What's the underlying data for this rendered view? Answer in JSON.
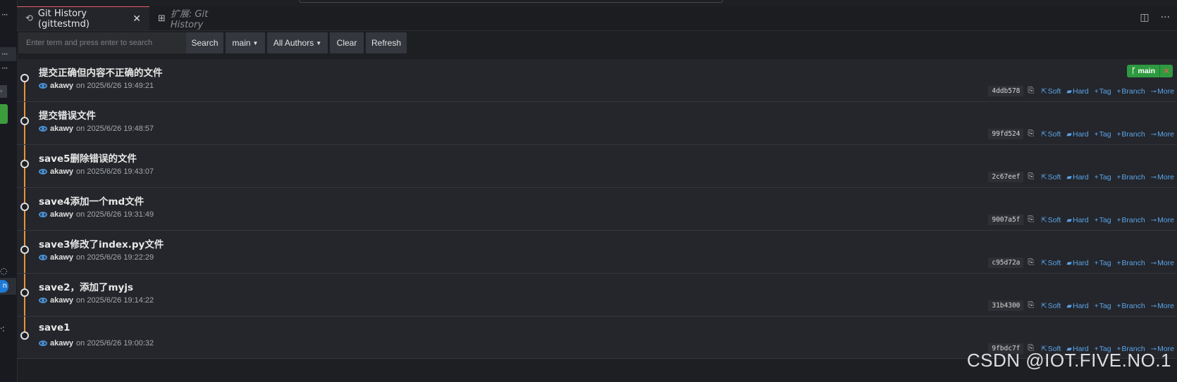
{
  "tabs": [
    {
      "label": "Git History (gittestmd)",
      "icon": "history-icon",
      "active": true
    },
    {
      "label": "扩展: Git History",
      "icon": "extensions-icon",
      "active": false
    }
  ],
  "toolbar": {
    "search_placeholder": "Enter term and press enter to search",
    "search_label": "Search",
    "branch_label": "main",
    "authors_label": "All Authors",
    "clear_label": "Clear",
    "refresh_label": "Refresh"
  },
  "branch_badge": {
    "label": "main",
    "color": "#2e9a40"
  },
  "action_labels": {
    "soft": "Soft",
    "hard": "Hard",
    "tag": "Tag",
    "branch": "Branch",
    "more": "More"
  },
  "commits": [
    {
      "message": "提交正确但内容不正确的文件",
      "author": "akawy",
      "date": "on 2025/6/26 19:49:21",
      "hash": "4ddb578"
    },
    {
      "message": "提交错误文件",
      "author": "akawy",
      "date": "on 2025/6/26 19:48:57",
      "hash": "99fd524"
    },
    {
      "message": "save5删除错误的文件",
      "author": "akawy",
      "date": "on 2025/6/26 19:43:07",
      "hash": "2c67eef"
    },
    {
      "message": "save4添加一个md文件",
      "author": "akawy",
      "date": "on 2025/6/26 19:31:49",
      "hash": "9007a5f"
    },
    {
      "message": "save3修改了index.py文件",
      "author": "akawy",
      "date": "on 2025/6/26 19:22:29",
      "hash": "c95d72a"
    },
    {
      "message": "save2，添加了myjs",
      "author": "akawy",
      "date": "on 2025/6/26 19:14:22",
      "hash": "31b4300"
    },
    {
      "message": "save1",
      "author": "akawy",
      "date": "on 2025/6/26 19:00:32",
      "hash": "9fbdc7f"
    }
  ],
  "colors": {
    "graph": "#e8923a",
    "link": "#5ba3e8",
    "active_tab_border": "#e8596b"
  },
  "sidebar": {
    "badge_text": "n"
  },
  "watermark": "CSDN @IOT.FIVE.NO.1"
}
